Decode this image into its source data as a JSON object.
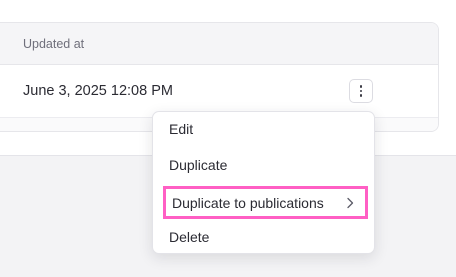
{
  "table": {
    "column_header": "Updated at",
    "rows": [
      {
        "updated_at": "June 3, 2025 12:08 PM"
      }
    ]
  },
  "context_menu": {
    "items": [
      {
        "label": "Edit"
      },
      {
        "label": "Duplicate"
      },
      {
        "label": "Duplicate to publications",
        "has_submenu": true,
        "highlighted": true,
        "highlight_color": "#ff5fc4"
      },
      {
        "label": "Delete"
      }
    ]
  },
  "icons": {
    "row_action": "more-vertical-icon",
    "submenu": "chevron-right-icon"
  }
}
